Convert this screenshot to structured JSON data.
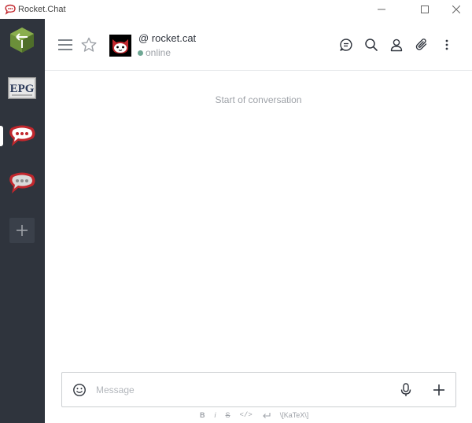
{
  "window": {
    "title": "Rocket.Chat"
  },
  "servers": [
    {
      "name": "Rocket.Chat server (green cube)",
      "icon": "green-cube-server-icon"
    },
    {
      "name": "EPG",
      "label": "EPG",
      "icon": "epg-server-icon"
    },
    {
      "name": "Rocket.Chat",
      "icon": "rocket-chat-server-icon",
      "active": true
    },
    {
      "name": "Rocket.Chat",
      "icon": "rocket-chat-server-icon"
    }
  ],
  "room": {
    "title": "@ rocket.cat",
    "status": "online",
    "status_color": "#6fa794"
  },
  "messages": {
    "start_text": "Start of conversation"
  },
  "composer": {
    "placeholder": "Message"
  },
  "format_bar": {
    "bold": "B",
    "italic": "i",
    "strike": "S",
    "code": "</>",
    "katex": "\\[KaTeX\\]"
  },
  "colors": {
    "sidebar": "#2f343d",
    "rocket_red": "#c1272d",
    "status_online": "#6fa794"
  }
}
